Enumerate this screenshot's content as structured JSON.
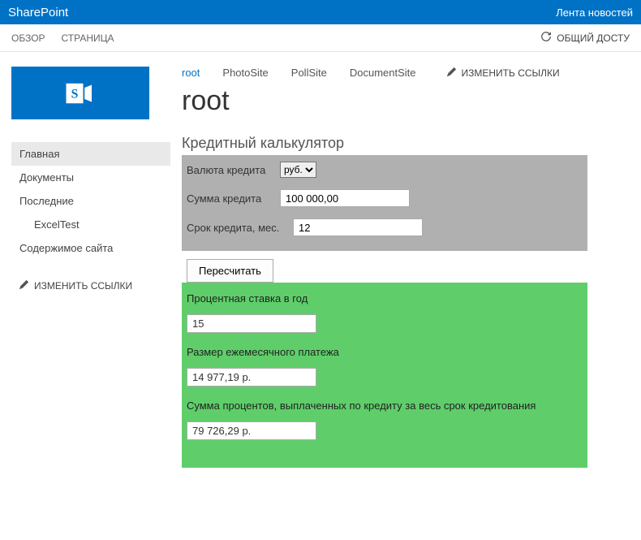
{
  "suite": {
    "brand": "SharePoint",
    "newsfeed": "Лента новостей"
  },
  "ribbon": {
    "tabs": [
      "ОБЗОР",
      "СТРАНИЦА"
    ],
    "share": "ОБЩИЙ ДОСТУ"
  },
  "quick_launch": {
    "items": [
      "Главная",
      "Документы",
      "Последние"
    ],
    "sub": "ExcelTest",
    "contents": "Содержимое сайта",
    "edit": "ИЗМЕНИТЬ ССЫЛКИ"
  },
  "top_nav": {
    "items": [
      "root",
      "PhotoSite",
      "PollSite",
      "DocumentSite"
    ],
    "edit": "ИЗМЕНИТЬ ССЫЛКИ"
  },
  "page": {
    "title": "root"
  },
  "calc": {
    "title": "Кредитный калькулятор",
    "currency_label": "Валюта кредита",
    "currency_value": "руб.",
    "amount_label": "Сумма кредита",
    "amount_value": "100 000,00",
    "term_label": "Срок кредита, мес.",
    "term_value": "12",
    "recalc": "Пересчитать"
  },
  "results": {
    "rate_label": "Процентная ставка в год",
    "rate_value": "15",
    "monthly_label": "Размер ежемесячного платежа",
    "monthly_value": "14 977,19 р.",
    "total_interest_label": "Сумма процентов, выплаченных по кредиту за весь срок кредитования",
    "total_interest_value": "79 726,29 р."
  }
}
